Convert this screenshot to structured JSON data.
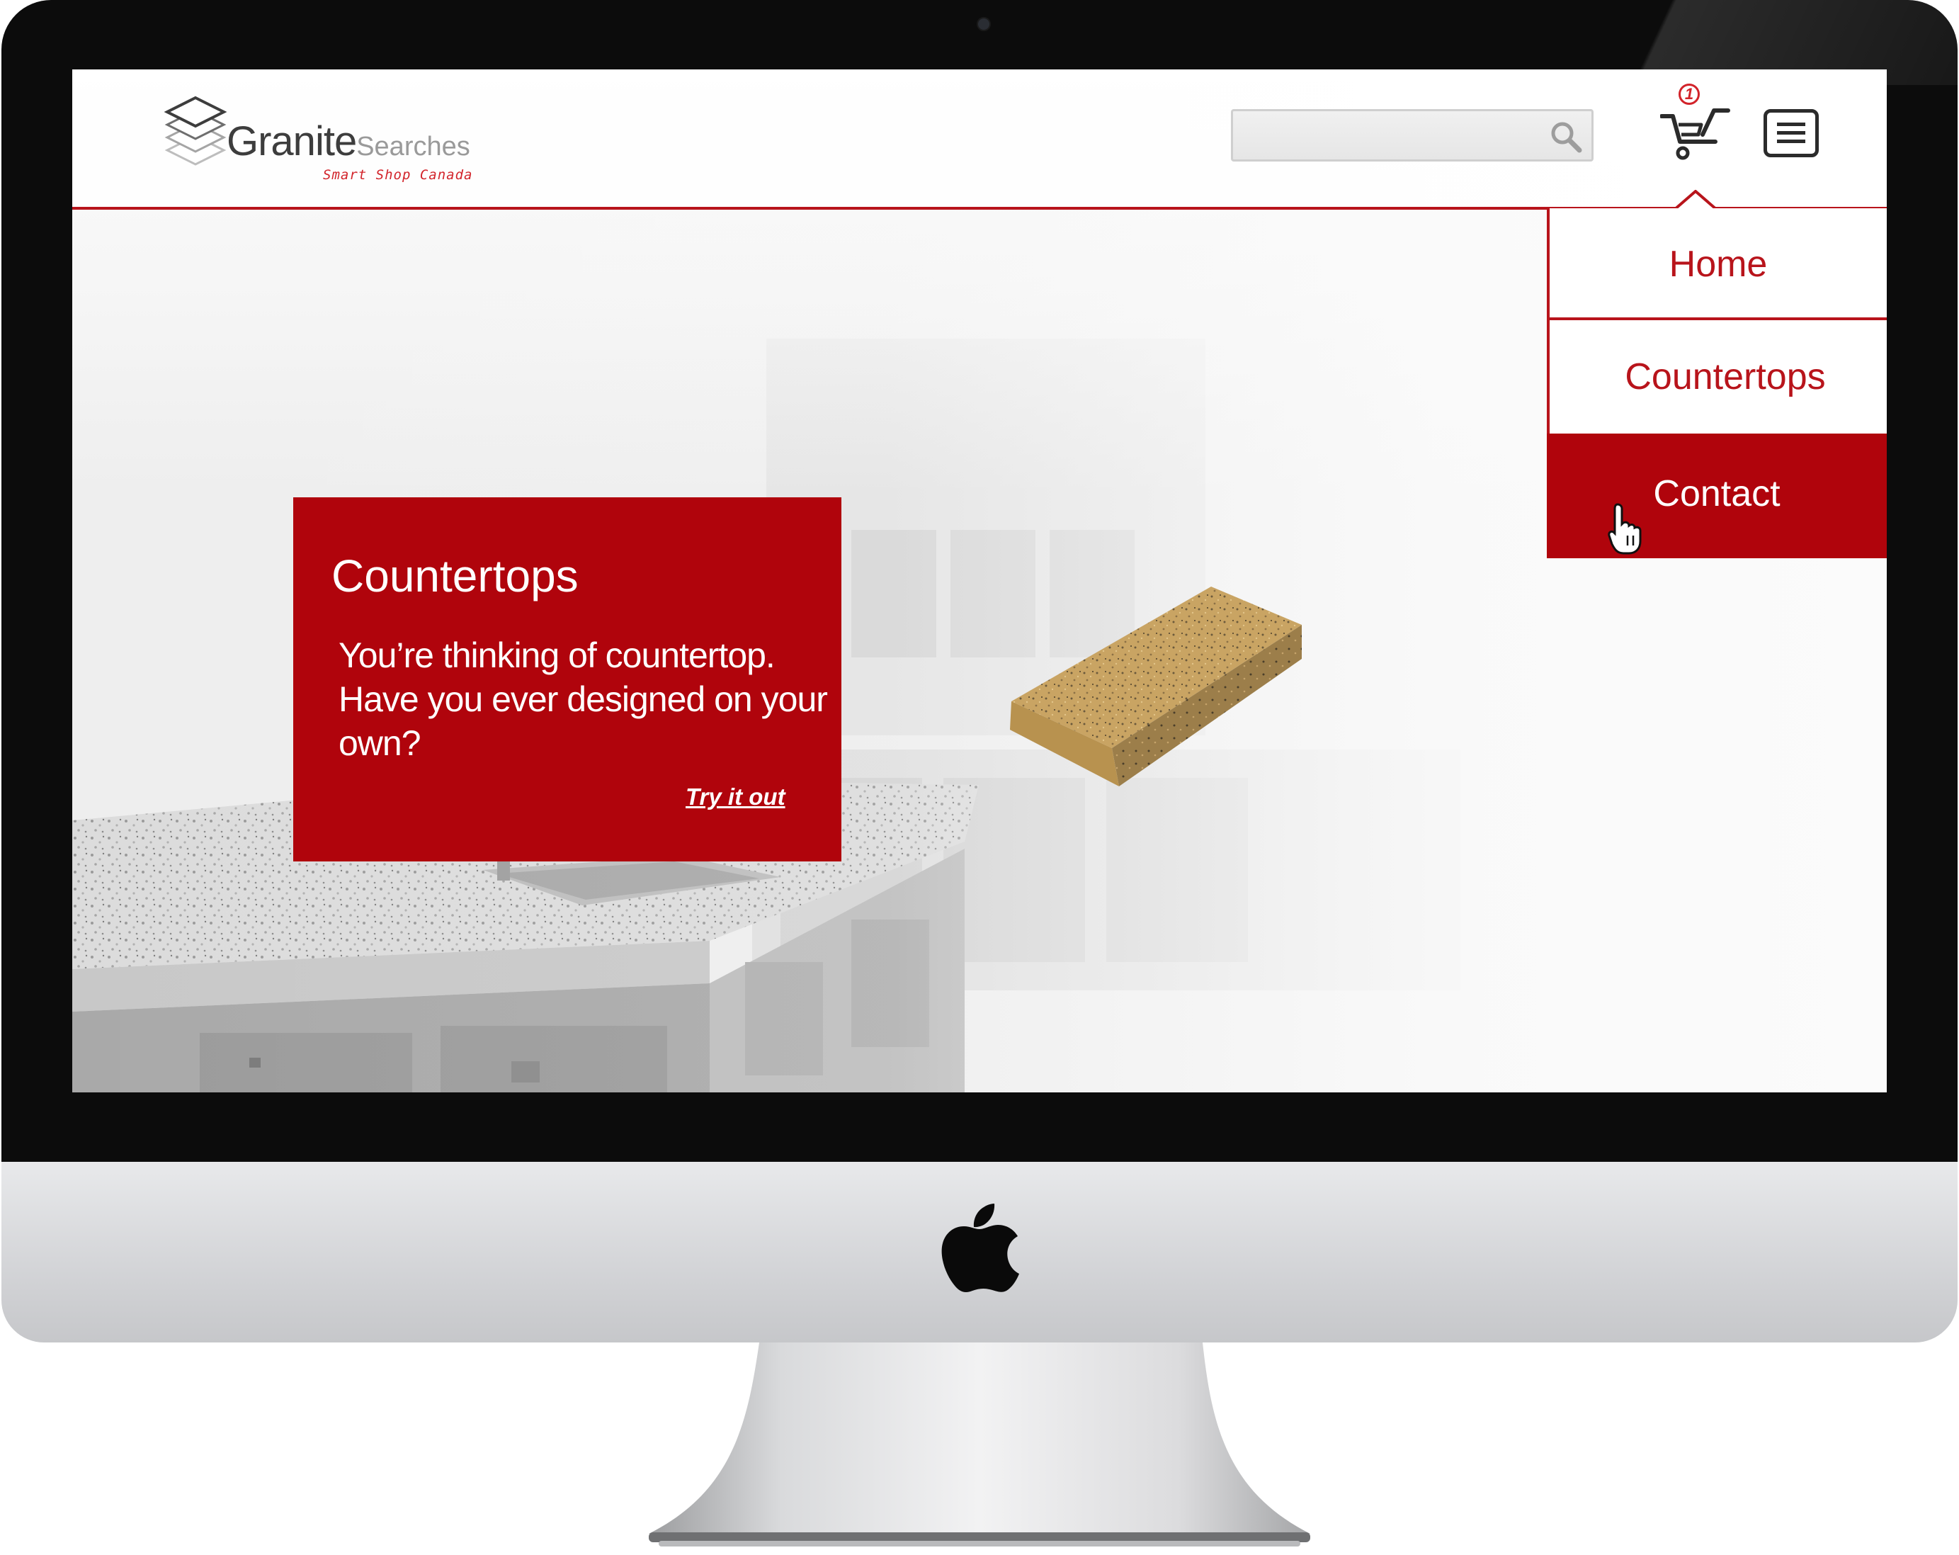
{
  "brand": {
    "name_primary": "Granite",
    "name_secondary": "Searches",
    "tagline": "Smart Shop Canada"
  },
  "search": {
    "placeholder": "",
    "value": ""
  },
  "cart": {
    "count": "1"
  },
  "nav": {
    "items": [
      {
        "label": "Home",
        "state": "normal"
      },
      {
        "label": "Countertops",
        "state": "normal"
      },
      {
        "label": "Contact",
        "state": "hover"
      }
    ]
  },
  "promo": {
    "title": "Countertops",
    "body": "You’re thinking of countertop. Have you ever designed on your own?",
    "link_label": "Try it out"
  },
  "colors": {
    "accent": "#b8141b",
    "promo_background": "#b0040c",
    "bezel": "#0c0c0c",
    "chin": "#d3d4d7"
  },
  "icons": [
    "logo-layers-icon",
    "search-icon",
    "cart-icon",
    "hamburger-menu-icon",
    "hand-cursor-icon",
    "apple-logo-icon"
  ]
}
